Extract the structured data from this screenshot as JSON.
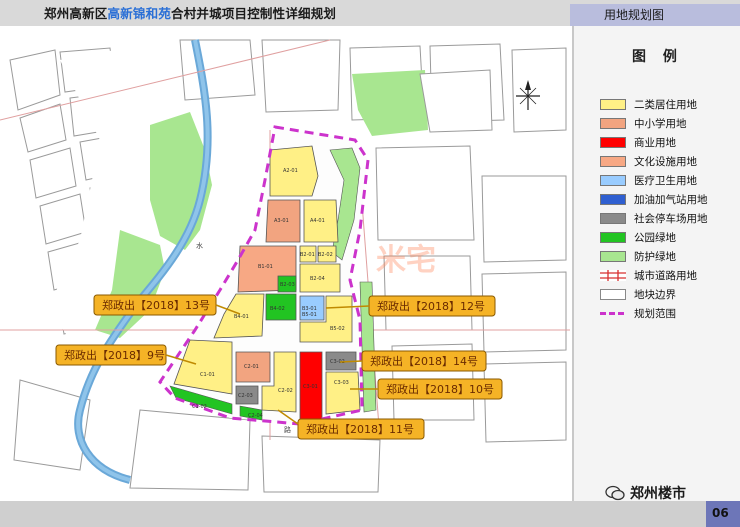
{
  "header": {
    "title_prefix": "郑州高新区",
    "title_highlight": "高新锦和苑",
    "title_suffix": "合村并城项目控制性详细规划",
    "page_label": "用地规划图"
  },
  "legend": {
    "heading": "图 例",
    "items": [
      {
        "label": "二类居住用地",
        "color": "#fff086",
        "icon": "fill"
      },
      {
        "label": "中小学用地",
        "color": "#f2a480",
        "icon": "fill"
      },
      {
        "label": "商业用地",
        "color": "#ff0000",
        "icon": "fill"
      },
      {
        "label": "文化设施用地",
        "color": "#f7a884",
        "icon": "fill"
      },
      {
        "label": "医疗卫生用地",
        "color": "#99ccff",
        "icon": "fill"
      },
      {
        "label": "加油加气站用地",
        "color": "#2f5fd0",
        "icon": "fill"
      },
      {
        "label": "社会停车场用地",
        "color": "#8a8a8a",
        "icon": "fill"
      },
      {
        "label": "公园绿地",
        "color": "#22c422",
        "icon": "fill"
      },
      {
        "label": "防护绿地",
        "color": "#a8e690",
        "icon": "fill"
      },
      {
        "label": "城市道路用地",
        "color": "#d83030",
        "icon": "road-line-icon"
      },
      {
        "label": "地块边界",
        "color": "#888888",
        "icon": "boundary-line-icon"
      },
      {
        "label": "规划范围",
        "color": "#cc33cc",
        "icon": "dashed-line-icon"
      }
    ]
  },
  "parcels": [
    "A2-01",
    "A3-01",
    "A4-01",
    "B1-01",
    "B2-01",
    "B2-02",
    "B2-03",
    "B2-04",
    "B3-01",
    "B4-01",
    "B4-02",
    "B5-01",
    "B5-02",
    "C1-01",
    "C1-02",
    "C2-01",
    "C2-02",
    "C2-03",
    "C2-04",
    "C3-01",
    "C3-02",
    "C3-03"
  ],
  "callouts": [
    {
      "text": "郑政出【2018】13号"
    },
    {
      "text": "郑政出【2018】12号"
    },
    {
      "text": "郑政出【2018】9号"
    },
    {
      "text": "郑政出【2018】14号"
    },
    {
      "text": "郑政出【2018】10号"
    },
    {
      "text": "郑政出【2018】11号"
    }
  ],
  "map_labels": {
    "watermark": "米宅",
    "river": "水",
    "street": "路"
  },
  "footer": {
    "wechat": "郑州楼市",
    "page_number": "06"
  }
}
